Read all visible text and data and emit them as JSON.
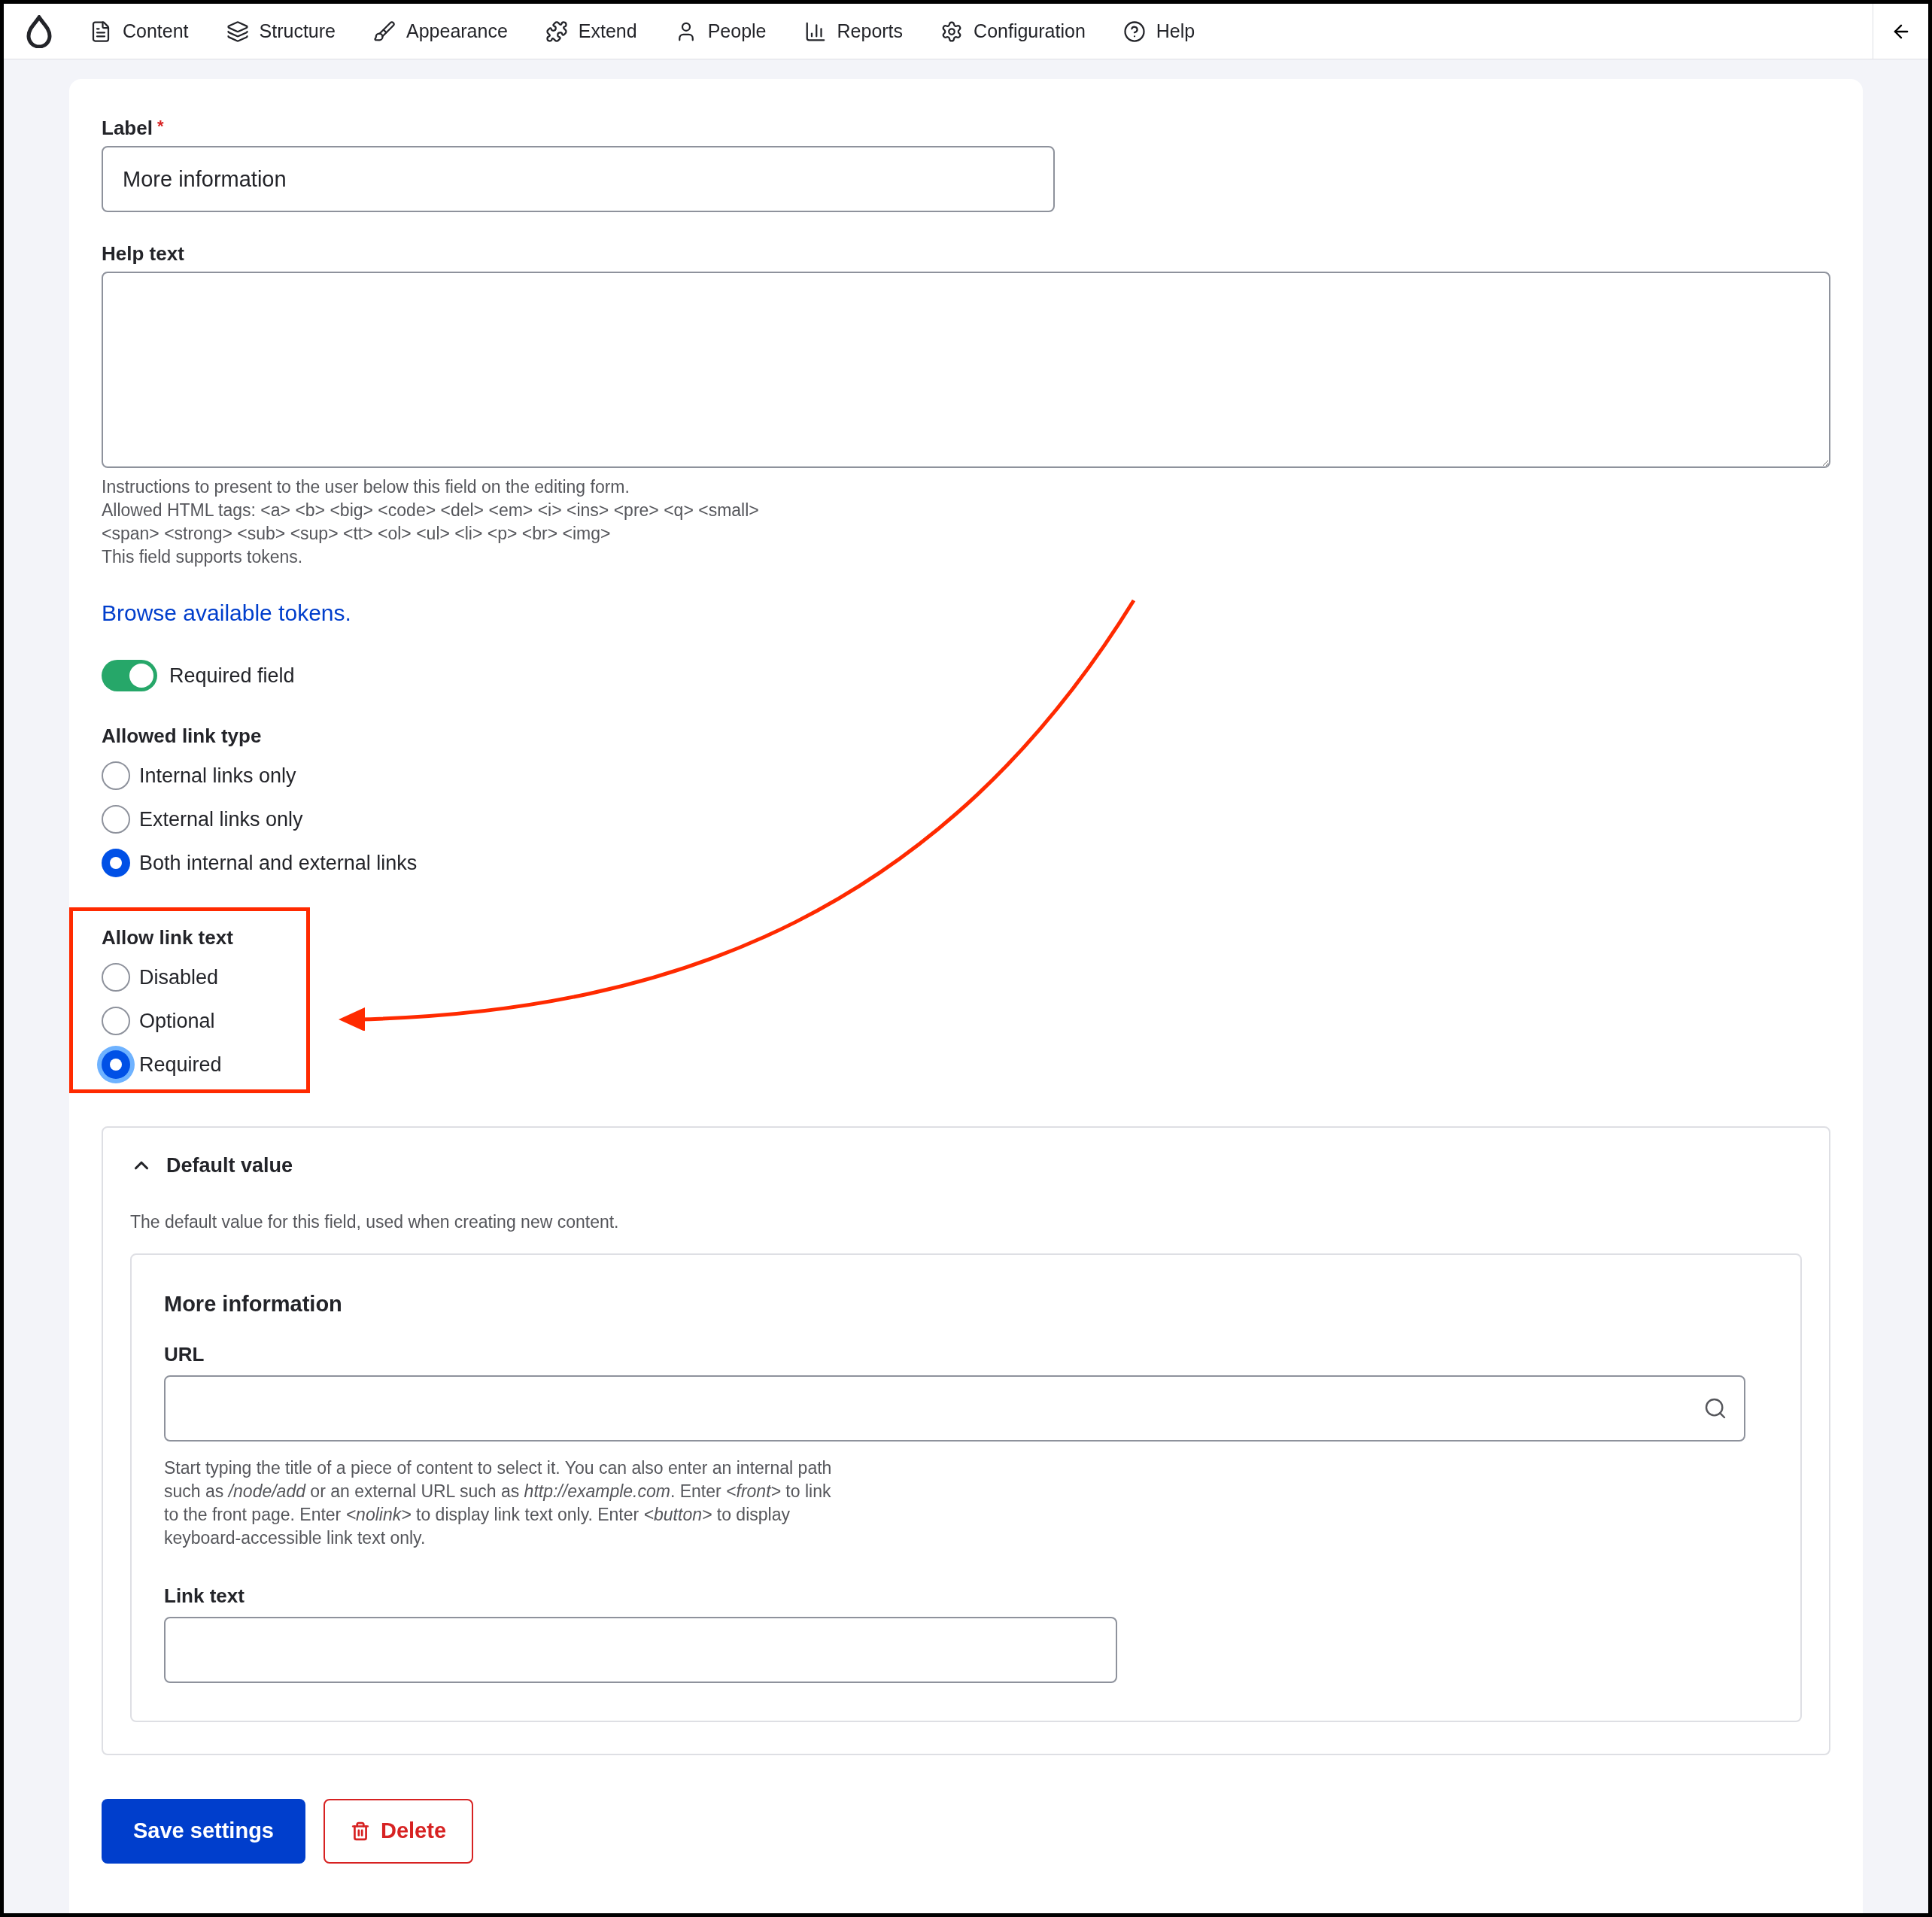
{
  "toolbar": {
    "items": [
      {
        "label": "Content"
      },
      {
        "label": "Structure"
      },
      {
        "label": "Appearance"
      },
      {
        "label": "Extend"
      },
      {
        "label": "People"
      },
      {
        "label": "Reports"
      },
      {
        "label": "Configuration"
      },
      {
        "label": "Help"
      }
    ]
  },
  "label_field": {
    "label": "Label",
    "required_mark": "*",
    "value": "More information"
  },
  "help_text_field": {
    "label": "Help text"
  },
  "help_description": [
    "Instructions to present to the user below this field on the editing form.",
    "Allowed HTML tags: <a> <b> <big> <code> <del> <em> <i> <ins> <pre> <q> <small>",
    "<span> <strong> <sub> <sup> <tt> <ol> <ul> <li> <p> <br> <img>",
    "This field supports tokens."
  ],
  "tokens_link": "Browse available tokens.",
  "required_toggle": {
    "label": "Required field",
    "on": true
  },
  "allowed_link_type": {
    "title": "Allowed link type",
    "highlighted": false,
    "options": [
      {
        "label": "Internal links only",
        "selected": false,
        "focused": false
      },
      {
        "label": "External links only",
        "selected": false,
        "focused": false
      },
      {
        "label": "Both internal and external links",
        "selected": true,
        "focused": false
      }
    ]
  },
  "allow_link_text": {
    "title": "Allow link text",
    "highlighted": true,
    "options": [
      {
        "label": "Disabled",
        "selected": false,
        "focused": false
      },
      {
        "label": "Optional",
        "selected": false,
        "focused": false
      },
      {
        "label": "Required",
        "selected": true,
        "focused": true
      }
    ]
  },
  "default_value": {
    "title": "Default value",
    "expanded": true,
    "description": "The default value for this field, used when creating new content.",
    "widget": {
      "title": "More information",
      "url_label": "URL",
      "url_help": "Start typing the title of a piece of content to select it. You can also enter an internal path such as */node/add* or an external URL such as *http://example.com*. Enter *<front>* to link to the front page. Enter *<nolink>* to display link text only. Enter *<button>* to display keyboard-accessible link text only.",
      "link_text_label": "Link text"
    }
  },
  "buttons": [
    {
      "label": "Save settings",
      "kind": "primary"
    },
    {
      "label": "Delete",
      "kind": "danger"
    }
  ]
}
